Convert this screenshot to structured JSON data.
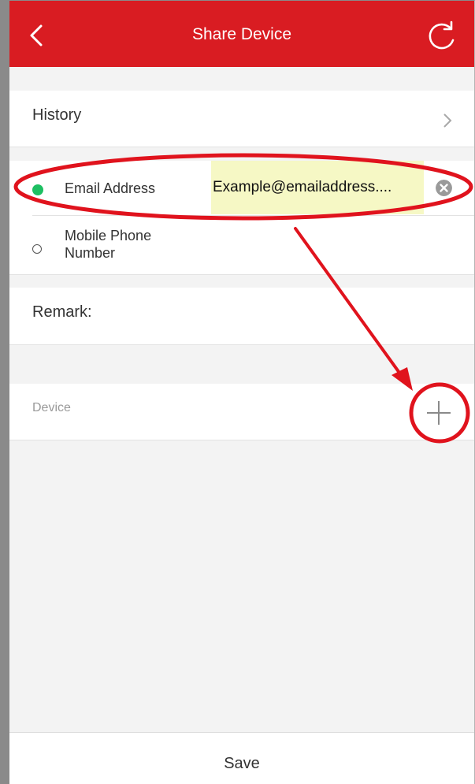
{
  "header": {
    "title": "Share Device",
    "color": "#d91c22"
  },
  "history": {
    "label": "History"
  },
  "contact": {
    "email_label": "Email Address",
    "email_value": "Example@emailaddress....",
    "phone_label_line1": "Mobile Phone",
    "phone_label_line2": "Number",
    "selected_radio_color": "#1dbf62"
  },
  "remark": {
    "label": "Remark:"
  },
  "device": {
    "label": "Device"
  },
  "footer": {
    "save_label": "Save"
  },
  "annotation": {
    "color": "#e0131d"
  }
}
